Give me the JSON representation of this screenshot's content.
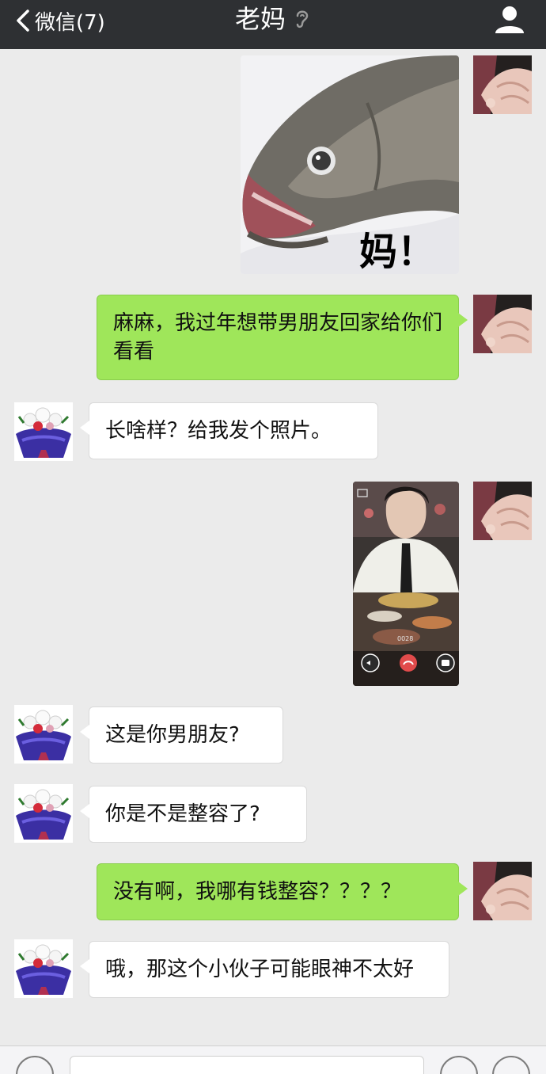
{
  "header": {
    "back_label": "微信(7)",
    "title": "老妈",
    "title_icon": "ear-icon",
    "right_icon": "person-icon"
  },
  "messages": [
    {
      "from": "me",
      "type": "sticker",
      "sticker_text": "妈！"
    },
    {
      "from": "me",
      "type": "text",
      "text": "麻麻，我过年想带男朋友回家给你们看看"
    },
    {
      "from": "mom",
      "type": "text",
      "text": "长啥样？给我发个照片。"
    },
    {
      "from": "me",
      "type": "image",
      "caption": "0028"
    },
    {
      "from": "mom",
      "type": "text",
      "text": "这是你男朋友?"
    },
    {
      "from": "mom",
      "type": "text",
      "text": "你是不是整容了?"
    },
    {
      "from": "me",
      "type": "text",
      "text": "没有啊，我哪有钱整容？？？？"
    },
    {
      "from": "mom",
      "type": "text",
      "text": "哦，那这个小伙子可能眼神不太好"
    }
  ],
  "colors": {
    "topbar": "#2e3033",
    "chat_bg": "#ebebeb",
    "my_bubble": "#9fe65a",
    "their_bubble": "#ffffff"
  }
}
